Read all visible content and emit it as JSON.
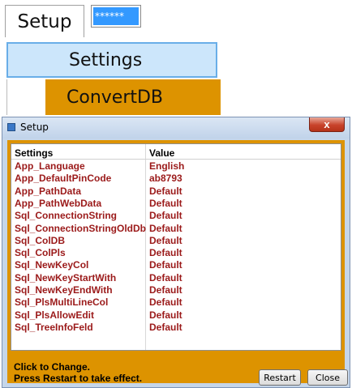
{
  "menu": {
    "setup_label": "Setup",
    "pin_value": "******",
    "settings_label": "Settings",
    "convert_label": "ConvertDB"
  },
  "window": {
    "title": "Setup",
    "close_glyph": "x"
  },
  "grid": {
    "columns": [
      "Settings",
      "Value"
    ],
    "rows": [
      [
        "App_Language",
        "English"
      ],
      [
        "App_DefaultPinCode",
        "ab8793"
      ],
      [
        "App_PathData",
        "Default"
      ],
      [
        "App_PathWebData",
        "Default"
      ],
      [
        "Sql_ConnectionString",
        "Default"
      ],
      [
        "Sql_ConnectionStringOldDb",
        "Default"
      ],
      [
        "Sql_ColDB",
        "Default"
      ],
      [
        "Sql_ColPls",
        "Default"
      ],
      [
        "Sql_NewKeyCol",
        "Default"
      ],
      [
        "Sql_NewKeyStartWith",
        "Default"
      ],
      [
        "Sql_NewKeyEndWith",
        "Default"
      ],
      [
        "Sql_PlsMultiLineCol",
        "Default"
      ],
      [
        "Sql_PlsAllowEdit",
        "Default"
      ],
      [
        "Sql_TreeInfoFeld",
        "Default"
      ]
    ]
  },
  "status": {
    "line1": "Click to Change.",
    "line2": "Press Restart to take effect."
  },
  "buttons": {
    "restart": "Restart",
    "close": "Close"
  },
  "colors": {
    "accent_orange": "#dd9300",
    "value_text": "#9b1a1a",
    "menu_highlight": "#cce6fb"
  }
}
